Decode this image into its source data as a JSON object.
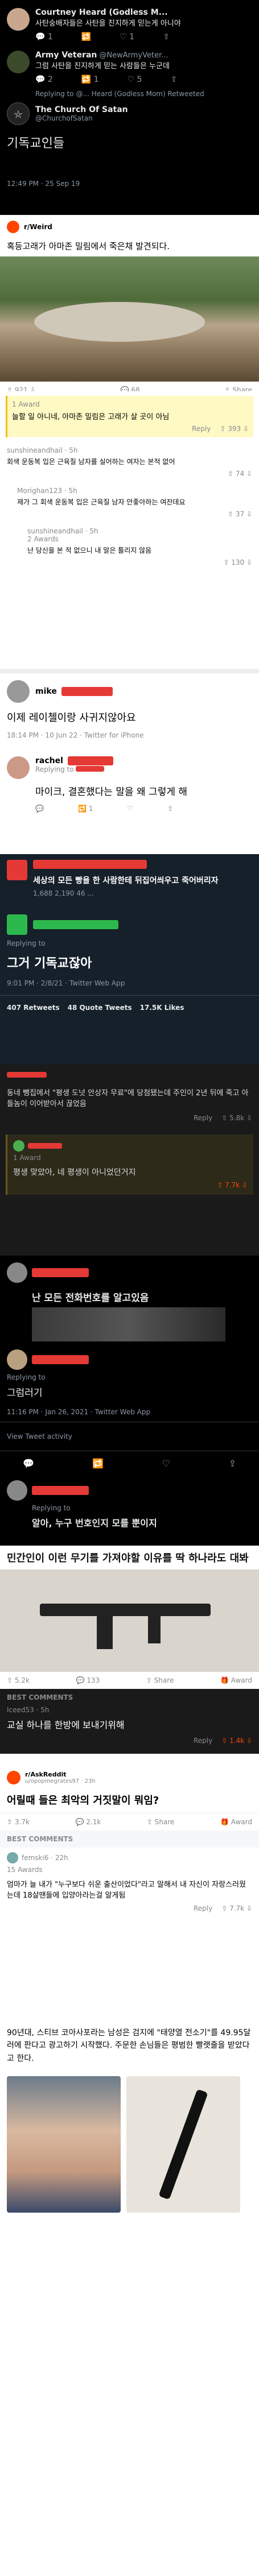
{
  "s1": {
    "tweets": [
      {
        "name": "Courtney Heard (Godless M...",
        "handle": "@...",
        "text": "사탄숭배자들은 사탄을 진지하게 믿는게 아니야",
        "r": "1",
        "rt": "",
        "like": "",
        "extra": "1"
      },
      {
        "name": "Army Veteran",
        "handle": "@NewArmyVeter...",
        "text": "그럼 사탄을 진지하게 믿는 사람들은 누군데",
        "r": "2",
        "rt": "1",
        "like": "5",
        "extra": ""
      }
    ],
    "reply_to": "Replying to @... Heard (Godless Mom) Retweeted",
    "satan_name": "The Church Of Satan",
    "satan_handle": "@ChurchofSatan",
    "satan_text": "기독교인들",
    "time": "12:49 PM · 25 Sep 19"
  },
  "s2": {
    "sub": "r/Weird",
    "title": "혹등고래가 아마존 밀림에서 죽은채 발견되다.",
    "up": "921",
    "comments": "68",
    "share": "Share"
  },
  "s3": {
    "award": "1 Award",
    "c1": "늘할 일 아니네, 아마존 밀림은 고래가 살 곳이 아님",
    "c1_reply": "Reply",
    "c1_votes": "393",
    "u2": "sunshineandhail · 5h",
    "c2": "회색 운동복 입은 근육질 남자를 실어하는 여자는 본적 없어",
    "c2_votes": "74",
    "u3": "Morighan123 · 5h",
    "c3": "제가 그 회색 운동복 입은 근육질 남자 안좋아하는 여잔데요",
    "c3_votes": "37",
    "u4": "sunshineandhail · 5h",
    "awards4": "2 Awards",
    "c4": "난 당신을 본 적 없으니 내 말은 틀리지 않음",
    "c4_votes": "130"
  },
  "s4": {
    "name1": "mike",
    "text1": "이제 레이첼이랑 사귀지않아요",
    "time1": "18:14 PM · 10 Jun 22 · Twitter for iPhone",
    "name2": "rachel",
    "replying": "Replying to",
    "text2": "마이크, 결혼했다는 말을 왜 그렇게 해",
    "r2": "1",
    "like2": ""
  },
  "s5": {
    "top_text": "세상의 모든 빵을 한 사람한테 뒤집어씌우고 죽어버리자",
    "stats": "1,688  2,190  46 ...",
    "reply_label": "Replying to",
    "text": "그거 기독교잖아",
    "time": "9:01 PM · 2/8/21 · Twitter Web App",
    "retweets": "407 Retweets",
    "quotes": "48 Quote Tweets",
    "likes": "17.5K Likes"
  },
  "s6": {
    "c1": "동네 뺑집에서 \"평생 도넛 안상자 무료\"에 당첨됐는데 주인이 2년 뒤에 죽고 아들놈이 이어받아서 끊었음",
    "reply": "Reply",
    "votes1": "5.8k",
    "award": "1 Award",
    "c2": "평생 맞았아, 네 평생이 아니었던거지",
    "votes2": "7.7k"
  },
  "s7": {
    "text1": "난 모든 전화번호를 알고있음",
    "replying": "Replying to",
    "text2": "그럼러기",
    "time": "11:16 PM · Jan 26, 2021 · Twitter Web App",
    "activity": "View Tweet activity",
    "text3": "알아, 누구 번호인지 모를 뿐이지"
  },
  "s8": {
    "title": "민간인이 이런 무기를 가져야할 이유를 딱 하나라도 대봐",
    "stat1": "5.2k",
    "stat2": "133",
    "stat3": "Share",
    "stat4": "Award",
    "best": "BEST COMMENTS",
    "user": "Iceed53 · 5h",
    "comment": "교실 하나를 한방에 보내기위해",
    "reply": "Reply",
    "votes": "1.4k"
  },
  "s9": {
    "sub": "r/AskReddit",
    "user": "u/opopmegrates97 · 23h",
    "title": "어릴때 들은 최악의 거짓말이 뭐임?",
    "up": "3.7k",
    "comments": "2.1k",
    "share": "Share",
    "award": "Award",
    "best": "BEST COMMENTS",
    "user2": "femski6 · 22h",
    "awards": "15 Awards",
    "c1": "엄마가 늘 내가 \"누구보다 쉬운 출산이었다\"라고 말해서 내 자신이 자랑스러웠는데 18살땐들에 입양아라는걸 알게됨",
    "reply": "Reply",
    "votes": "7.7k"
  },
  "s10": {
    "text": "90년대, 스티브 코아사포라는 남성은 검지에 \"태양열 전소기\"를 49.95달러에 판다고 광고하기 시작했다. 주문한 손님들은 평범한 빨랫줄을 받았다고 한다."
  }
}
